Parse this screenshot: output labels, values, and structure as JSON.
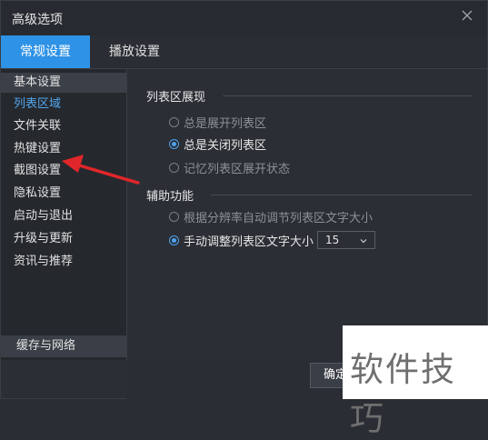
{
  "window": {
    "title": "高级选项"
  },
  "tabs": [
    {
      "label": "常规设置",
      "active": true
    },
    {
      "label": "播放设置",
      "active": false
    }
  ],
  "sidebar": {
    "items": [
      {
        "label": "基本设置"
      },
      {
        "label": "列表区域"
      },
      {
        "label": "文件关联"
      },
      {
        "label": "热键设置"
      },
      {
        "label": "截图设置"
      },
      {
        "label": "隐私设置"
      },
      {
        "label": "启动与退出"
      },
      {
        "label": "升级与更新"
      },
      {
        "label": "资讯与推荐"
      }
    ],
    "bottom_label": "缓存与网络"
  },
  "list_display": {
    "title": "列表区展现",
    "options": [
      {
        "label": "总是展开列表区",
        "checked": false
      },
      {
        "label": "总是关闭列表区",
        "checked": true
      },
      {
        "label": "记忆列表区展开状态",
        "checked": false
      }
    ]
  },
  "assist": {
    "title": "辅助功能",
    "options": [
      {
        "label": "根据分辨率自动调节列表区文字大小",
        "checked": false
      },
      {
        "label": "手动调整列表区文字大小",
        "checked": true
      }
    ],
    "font_size_value": "15"
  },
  "footer": {
    "ok_label": "确定"
  },
  "watermark": {
    "text": "软件技巧"
  },
  "icons": {
    "close": "close-icon",
    "dropdown": "chevron-down-icon"
  },
  "colors": {
    "accent": "#2e92e6",
    "radio_selected": "#4da2ef",
    "link_blue": "#52a6ee",
    "annotation_red": "#e0262a"
  }
}
